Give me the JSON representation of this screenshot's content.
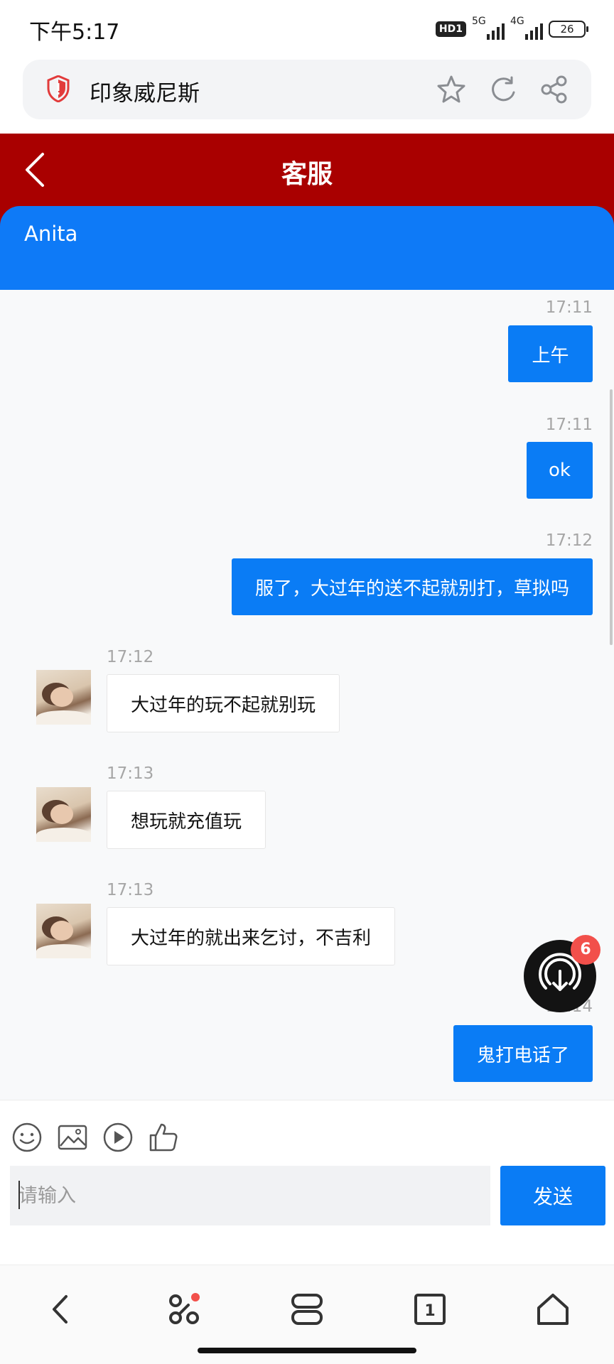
{
  "status_bar": {
    "time": "下午5:17",
    "hd_label": "HD1",
    "net1_label": "5G",
    "net2_label": "4G",
    "battery": "26"
  },
  "browser": {
    "page_title": "印象威尼斯",
    "icons": [
      "shield-icon",
      "star-icon",
      "refresh-icon",
      "share-icon"
    ]
  },
  "header": {
    "title": "客服"
  },
  "agent": {
    "name": "Anita"
  },
  "messages": [
    {
      "side": "out",
      "time": "17:11",
      "text": "上午"
    },
    {
      "side": "out",
      "time": "17:11",
      "text": "ok"
    },
    {
      "side": "out",
      "time": "17:12",
      "text": "服了，大过年的送不起就别打，草拟吗"
    },
    {
      "side": "in",
      "time": "17:12",
      "text": "大过年的玩不起就别玩"
    },
    {
      "side": "in",
      "time": "17:13",
      "text": "想玩就充值玩"
    },
    {
      "side": "in",
      "time": "17:13",
      "text": "大过年的就出来乞讨，不吉利"
    },
    {
      "side": "out",
      "time": "17:14",
      "text": "鬼打电话了"
    }
  ],
  "floating": {
    "badge": "6",
    "icon": "broadcast-icon"
  },
  "composer": {
    "tools": [
      "emoji-icon",
      "image-icon",
      "video-icon",
      "thumbs-up-icon"
    ],
    "placeholder": "请输入",
    "send_label": "发送"
  },
  "browser_nav": {
    "icons": [
      "back-icon",
      "apps-icon",
      "tabs-icon",
      "tab-count-icon",
      "home-icon"
    ],
    "tab_count": "1"
  },
  "colors": {
    "header_red": "#a90000",
    "accent_blue": "#0a7cf5",
    "badge_red": "#f2504b"
  }
}
